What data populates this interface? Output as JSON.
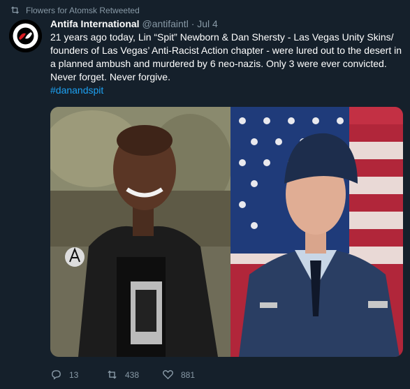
{
  "retweet": {
    "label": "Flowers for Atomsk Retweeted",
    "name": "Flowers for Atomsk",
    "suffix": "Retweeted"
  },
  "tweet": {
    "author_name": "Antifa International",
    "handle": "@antifaintl",
    "date": "· Jul 4",
    "lines": [
      "21 years ago today, Lin “Spit” Newborn & Dan Shersty - Las Vegas Unity Skins/",
      "founders of Las Vegas’ Anti-Racist Action chapter - were lured out to the desert in",
      "a planned ambush and murdered by 6 neo-nazis.  Only 3 were ever convicted.",
      "Never forget.  Never forgive."
    ],
    "hashtag": "#danandspit",
    "avatar_text": "Antifa International"
  },
  "actions": {
    "replies": "13",
    "retweets": "438",
    "likes": "881"
  },
  "colors": {
    "background": "#15202b",
    "muted": "#8899a6",
    "accent": "#1da1f2"
  }
}
